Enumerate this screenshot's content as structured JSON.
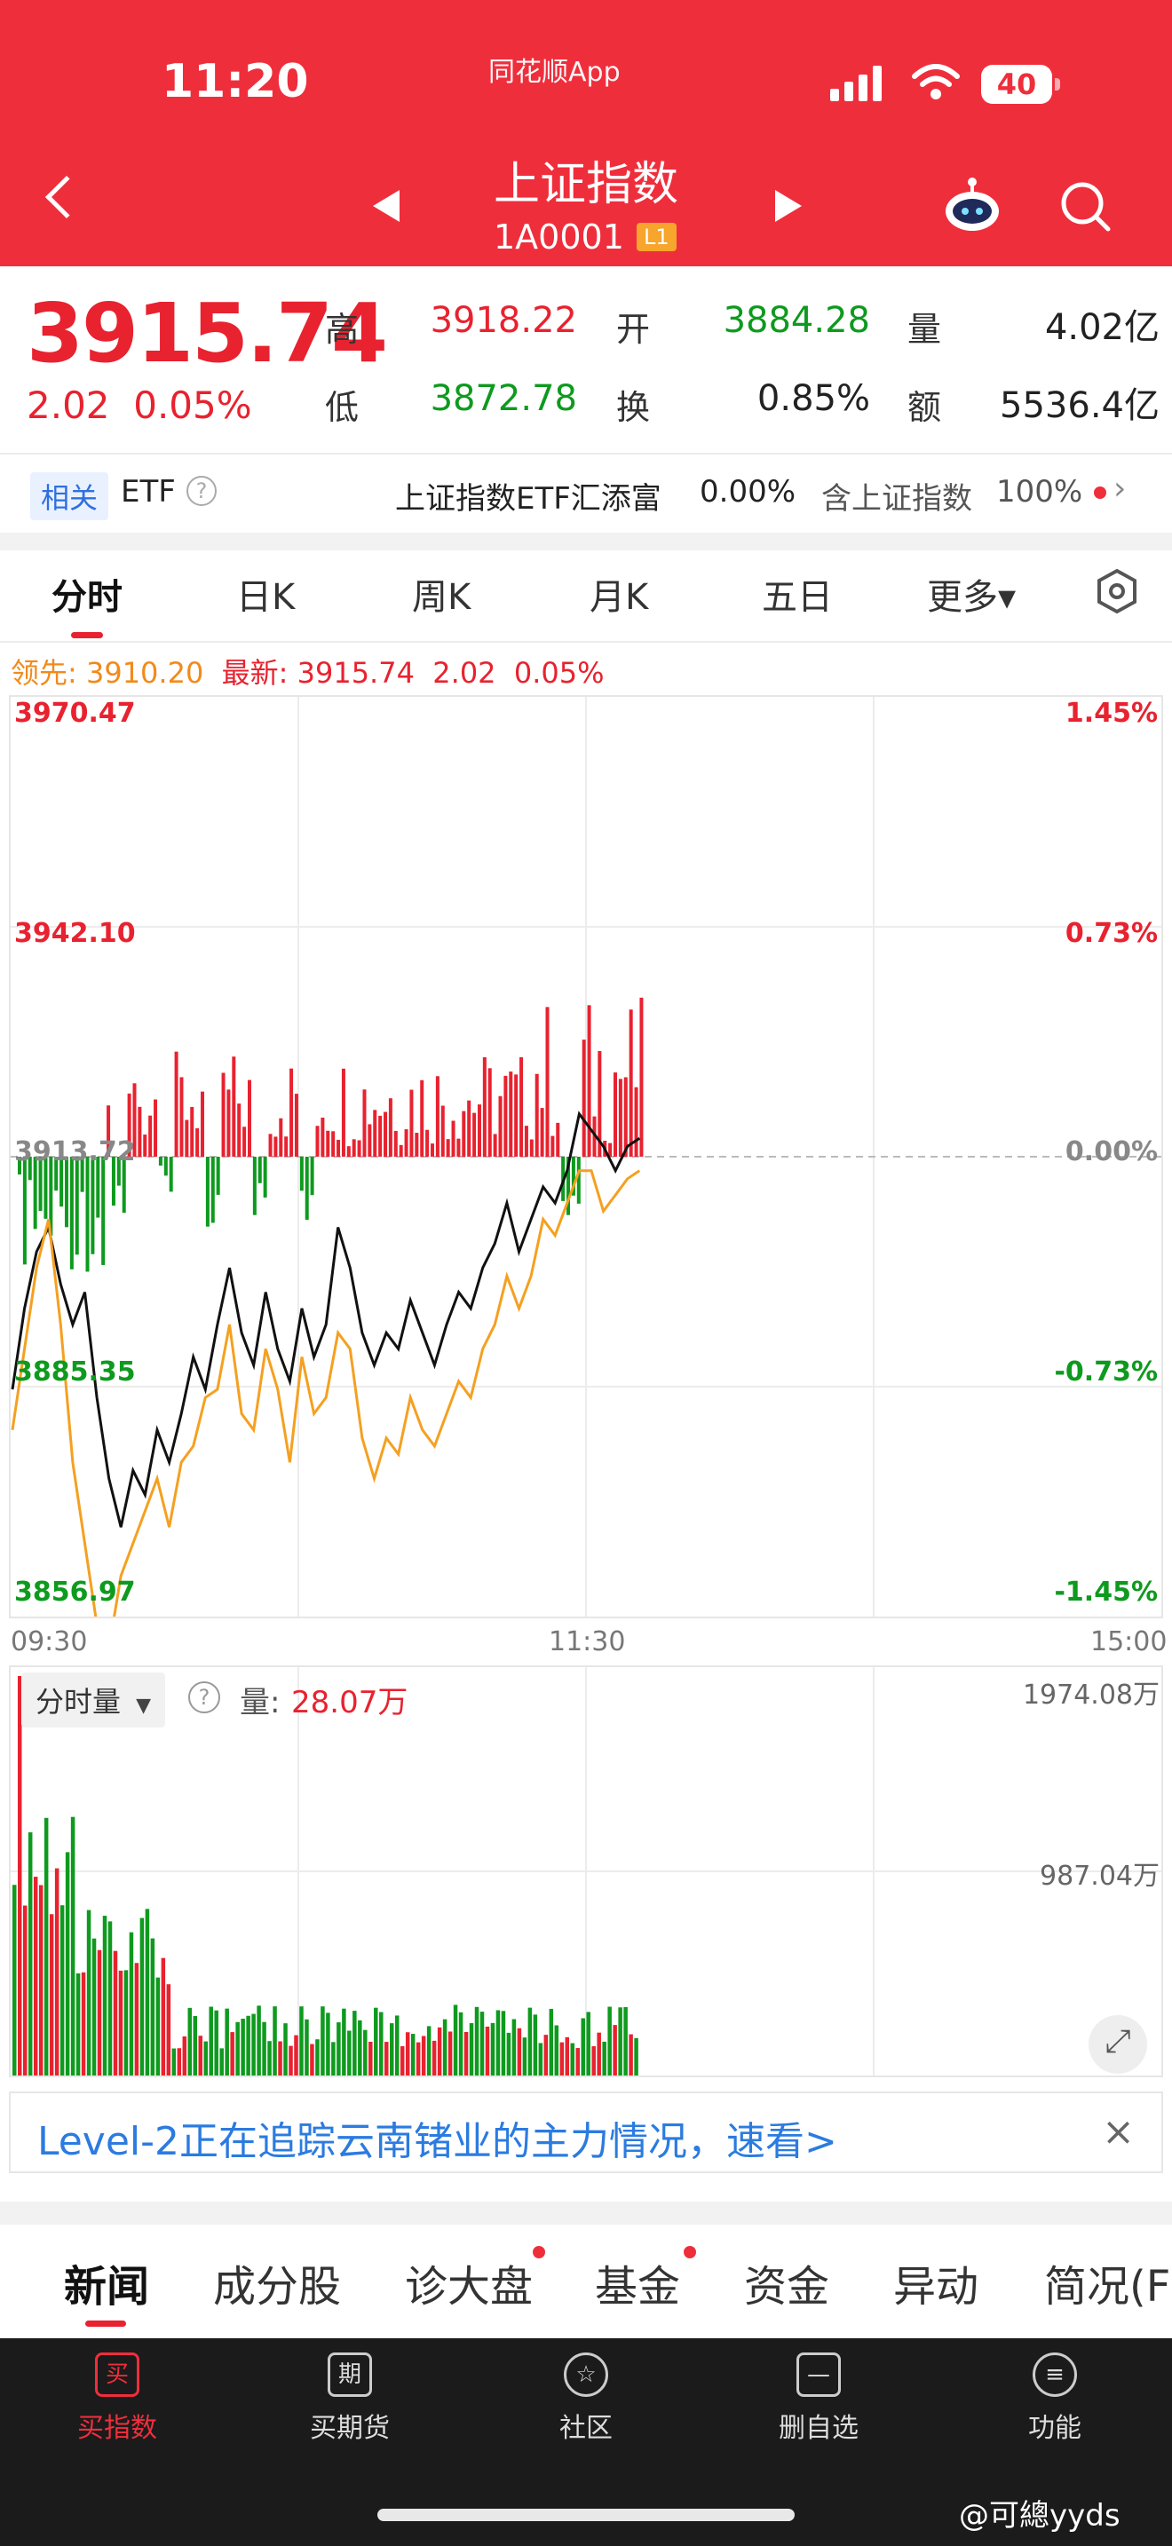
{
  "status": {
    "time": "11:20",
    "app": "同花顺App",
    "battery": "40"
  },
  "header": {
    "title": "上证指数",
    "code": "1A0001",
    "level": "L1"
  },
  "quote": {
    "price": "3915.74",
    "change": "2.02",
    "change_pct": "0.05%",
    "high_label": "高",
    "high": "3918.22",
    "open_label": "开",
    "open": "3884.28",
    "vol_label": "量",
    "vol": "4.02亿",
    "low_label": "低",
    "low": "3872.78",
    "turn_label": "换",
    "turn": "0.85%",
    "amt_label": "额",
    "amt": "5536.4亿"
  },
  "etf": {
    "related": "相关",
    "etf": "ETF",
    "name": "上证指数ETF汇添富",
    "pct": "0.00%",
    "contains": "含上证指数",
    "contains_pct": "100%"
  },
  "tabs": [
    "分时",
    "日K",
    "周K",
    "月K",
    "五日",
    "更多▾"
  ],
  "lead": {
    "lead_label": "领先:",
    "lead_value": "3910.20",
    "latest_label": "最新:",
    "latest_value": "3915.74",
    "chg": "2.02",
    "pct": "0.05%"
  },
  "chart_labels": {
    "y_left": [
      "3970.47",
      "3942.10",
      "3913.72",
      "3885.35",
      "3856.97"
    ],
    "y_right": [
      "1.45%",
      "0.73%",
      "0.00%",
      "-0.73%",
      "-1.45%"
    ],
    "x": [
      "09:30",
      "11:30",
      "15:00"
    ]
  },
  "volume": {
    "selector": "分时量",
    "label": "量:",
    "value": "28.07万",
    "max": "1974.08万",
    "mid": "987.04万"
  },
  "banner": {
    "text": "Level-2正在追踪云南锗业的主力情况，速看>",
    "close": "×"
  },
  "news_tabs": [
    "新闻",
    "成分股",
    "诊大盘",
    "基金",
    "资金",
    "异动",
    "简况(F"
  ],
  "bottom_nav": [
    {
      "icon": "买",
      "label": "买指数"
    },
    {
      "icon": "期",
      "label": "买期货"
    },
    {
      "icon": "☆",
      "label": "社区"
    },
    {
      "icon": "—",
      "label": "删自选"
    },
    {
      "icon": "≡",
      "label": "功能"
    }
  ],
  "watermark": "@可總yyds",
  "chart_data": {
    "type": "line",
    "x_range": [
      "09:30",
      "15:00"
    ],
    "prev_close": 3913.72,
    "ylim": [
      3856.97,
      3970.47
    ],
    "series": [
      {
        "color": "#111111",
        "values": [
          3885,
          3895,
          3902,
          3905,
          3898,
          3893,
          3897,
          3884,
          3874,
          3868,
          3875,
          3872,
          3880,
          3876,
          3882,
          3889,
          3885,
          3893,
          3900,
          3892,
          3888,
          3897,
          3890,
          3886,
          3895,
          3889,
          3893,
          3905,
          3900,
          3892,
          3888,
          3892,
          3890,
          3896,
          3892,
          3888,
          3893,
          3897,
          3895,
          3900,
          3903,
          3908,
          3902,
          3906,
          3910,
          3908,
          3912,
          3919,
          3917,
          3915,
          3912,
          3915,
          3916
        ]
      },
      {
        "color": "#f5a020",
        "values": [
          3880,
          3890,
          3900,
          3906,
          3893,
          3876,
          3866,
          3856,
          3853,
          3862,
          3866,
          3870,
          3874,
          3868,
          3876,
          3878,
          3884,
          3885,
          3893,
          3882,
          3880,
          3890,
          3885,
          3876,
          3889,
          3882,
          3884,
          3892,
          3890,
          3879,
          3874,
          3879,
          3877,
          3884,
          3880,
          3878,
          3882,
          3886,
          3884,
          3890,
          3893,
          3899,
          3895,
          3899,
          3906,
          3904,
          3908,
          3912,
          3912,
          3907,
          3909,
          3911,
          3912
        ]
      }
    ]
  }
}
